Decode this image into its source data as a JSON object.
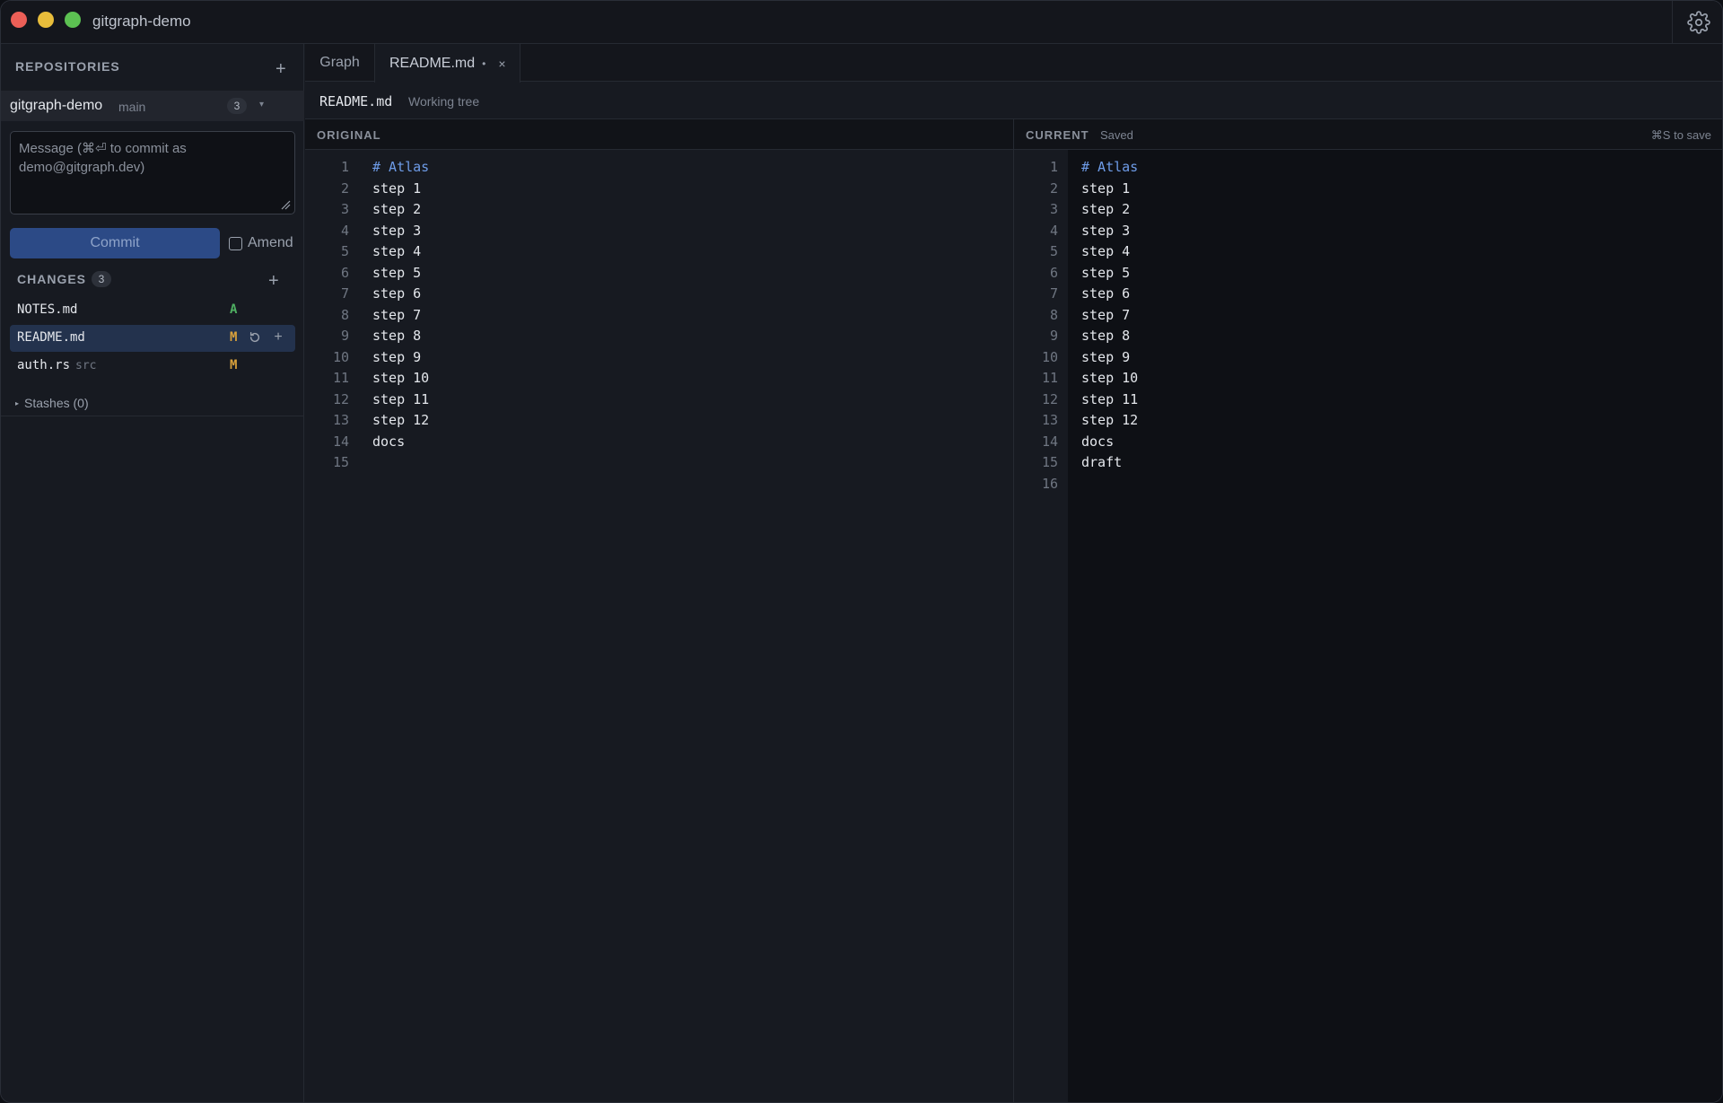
{
  "app": {
    "title": "gitgraph-demo"
  },
  "sidebar": {
    "repositories_heading": "REPOSITORIES",
    "repo": {
      "name": "gitgraph-demo",
      "branch": "main",
      "count": "3"
    },
    "commit_message_placeholder": "Message (⌘⏎ to commit as demo@gitgraph.dev)",
    "commit_label": "Commit",
    "amend_label": "Amend",
    "changes_heading": "CHANGES",
    "changes_count": "3",
    "changes": [
      {
        "name": "NOTES.md",
        "dir": "",
        "status": "A"
      },
      {
        "name": "README.md",
        "dir": "",
        "status": "M"
      },
      {
        "name": "auth.rs",
        "dir": "src",
        "status": "M"
      }
    ],
    "stashes_label": "Stashes (0)"
  },
  "tabs": [
    {
      "label": "Graph"
    },
    {
      "label": "README.md",
      "modified_marker": "•",
      "close": "×"
    }
  ],
  "pathbar": {
    "file": "README.md",
    "description": "Working tree"
  },
  "diff": {
    "original": {
      "title": "ORIGINAL",
      "lines": [
        "# Atlas",
        "step 1",
        "step 2",
        "step 3",
        "step 4",
        "step 5",
        "step 6",
        "step 7",
        "step 8",
        "step 9",
        "step 10",
        "step 11",
        "step 12",
        "docs",
        ""
      ]
    },
    "current": {
      "title": "CURRENT",
      "status": "Saved",
      "hint": "⌘S to save",
      "lines": [
        "# Atlas",
        "step 1",
        "step 2",
        "step 3",
        "step 4",
        "step 5",
        "step 6",
        "step 7",
        "step 8",
        "step 9",
        "step 10",
        "step 11",
        "step 12",
        "docs",
        "draft",
        ""
      ]
    }
  },
  "colors": {
    "accent": "#2c4a86",
    "added": "#4fb062",
    "modified": "#d9a13b",
    "heading": "#6e9ce8"
  }
}
